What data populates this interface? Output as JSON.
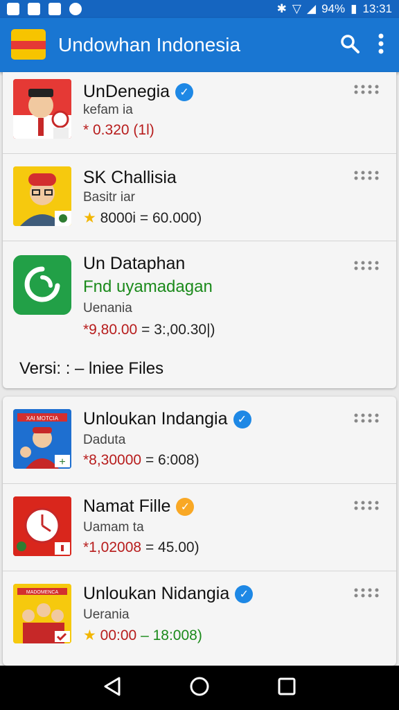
{
  "status": {
    "battery": "94%",
    "time": "13:31"
  },
  "appbar": {
    "title": "Undowhan Indonesia"
  },
  "items": [
    {
      "name": "UnDenegia",
      "verified": "blue",
      "sub": "kefam ia",
      "price": "* 0.320",
      "price_tail": "(1l)"
    },
    {
      "name": "SK Challisia",
      "sub": "Basitr iar",
      "star": true,
      "price": "8000i",
      "price_tail": "= 60.000)"
    },
    {
      "name": "Un Dataphan",
      "green": "Fnd uyamadagan",
      "sub": "Uenania",
      "price": "*9,80.00",
      "price_tail": "= 3:,00.30|)",
      "footer": "Versi: : – lniee Files"
    },
    {
      "name": "Unloukan Indangia",
      "verified": "blue",
      "sub": "Daduta",
      "price": "*8,30000",
      "price_tail": "= 6:008)"
    },
    {
      "name": "Namat Fille",
      "verified": "orange",
      "sub": "Uamam ta",
      "price": "*1,02008",
      "price_tail": "= 45.00)"
    },
    {
      "name": "Unloukan Nidangia",
      "verified": "blue",
      "sub": "Uerania",
      "star": true,
      "price": "00:00",
      "price_tail": "– 18:008)"
    }
  ],
  "thumb4_banner": "XAI MOTCIA",
  "thumb6_banner": "MADOMENCA",
  "colors": {
    "appbar": "#1976d2",
    "statusbar": "#1565c0",
    "price": "#b71c1c",
    "verify_blue": "#1e88e5",
    "verify_orange": "#f9a825"
  }
}
